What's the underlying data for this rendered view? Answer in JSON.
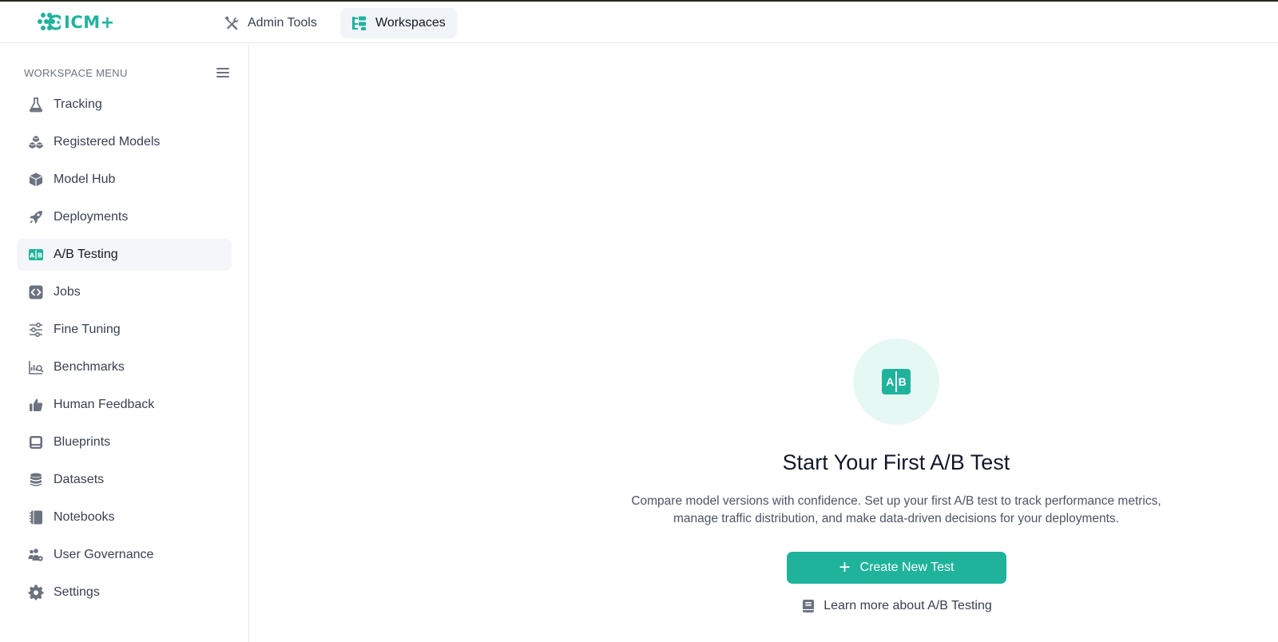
{
  "app": {
    "logo_text": "ICM+",
    "brand_color": "#1fb39c"
  },
  "topnav": {
    "tabs": [
      {
        "label": "Admin Tools",
        "icon": "tools-icon",
        "active": false
      },
      {
        "label": "Workspaces",
        "icon": "workspaces-icon",
        "active": true
      }
    ]
  },
  "sidebar": {
    "title": "WORKSPACE MENU",
    "items": [
      {
        "label": "Tracking",
        "icon": "flask-icon"
      },
      {
        "label": "Registered Models",
        "icon": "cubes-icon"
      },
      {
        "label": "Model Hub",
        "icon": "box-icon"
      },
      {
        "label": "Deployments",
        "icon": "rocket-icon"
      },
      {
        "label": "A/B Testing",
        "icon": "ab-testing-icon",
        "active": true
      },
      {
        "label": "Jobs",
        "icon": "code-icon"
      },
      {
        "label": "Fine Tuning",
        "icon": "sliders-icon"
      },
      {
        "label": "Benchmarks",
        "icon": "chart-search-icon"
      },
      {
        "label": "Human Feedback",
        "icon": "thumbs-up-icon"
      },
      {
        "label": "Blueprints",
        "icon": "blueprint-icon"
      },
      {
        "label": "Datasets",
        "icon": "database-icon"
      },
      {
        "label": "Notebooks",
        "icon": "notebook-icon"
      },
      {
        "label": "User Governance",
        "icon": "users-icon"
      },
      {
        "label": "Settings",
        "icon": "gear-icon"
      }
    ]
  },
  "empty_state": {
    "badge_left": "A",
    "badge_right": "B",
    "title": "Start Your First A/B Test",
    "description_line1": "Compare model versions with confidence. Set up your first A/B test to track performance metrics,",
    "description_line2": "manage traffic distribution, and make data-driven decisions for your deployments.",
    "create_button": "Create New Test",
    "learn_more": "Learn more about A/B Testing"
  }
}
